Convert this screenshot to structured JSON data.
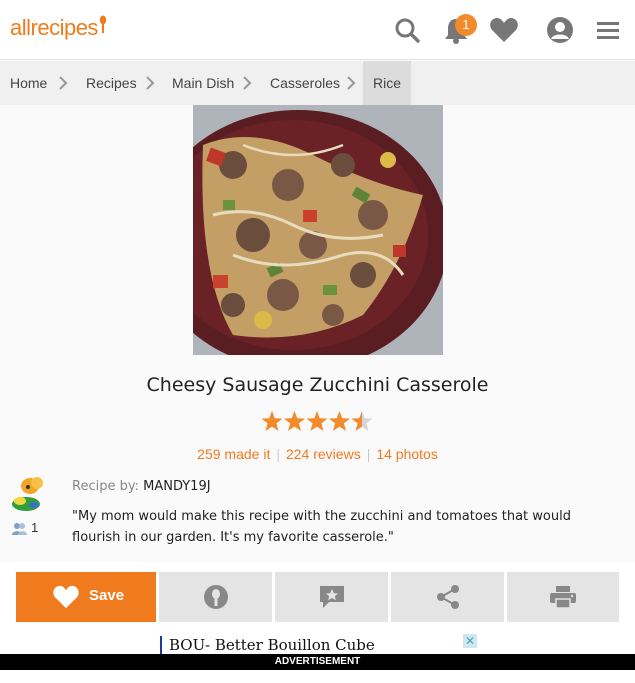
{
  "header": {
    "logo_text": "allrecipes",
    "notification_count": "1"
  },
  "breadcrumb": [
    "Home",
    "Recipes",
    "Main Dish",
    "Casseroles",
    "Rice"
  ],
  "recipe": {
    "title": "Cheesy Sausage Zucchini Casserole",
    "rating": 4.5,
    "made_it": "259 made it",
    "reviews": "224 reviews",
    "photos": "14 photos",
    "byline_label": "Recipe by:",
    "author": "MANDY19J",
    "followers": "1",
    "description": "\"My mom would make this recipe with the zucchini and tomatoes that would flourish in our garden. It's my favorite casserole.\""
  },
  "actions": {
    "save_label": "Save"
  },
  "ad": {
    "text": "BOU- Better Bouillon Cube",
    "close": "✕",
    "label": "ADVERTISEMENT"
  },
  "colors": {
    "brand": "#f07b1e",
    "star": "#f38a2b"
  },
  "icons": [
    "search-icon",
    "bell-icon",
    "heart-icon",
    "user-icon",
    "menu-icon",
    "made-it-icon",
    "review-icon",
    "share-icon",
    "print-icon"
  ]
}
